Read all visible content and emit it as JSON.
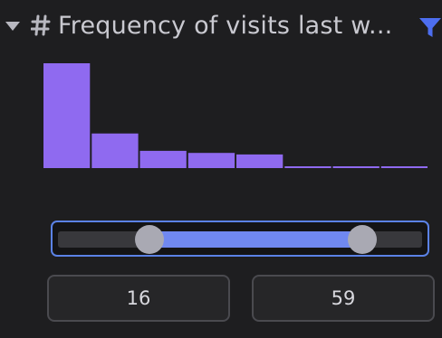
{
  "header": {
    "title": "Frequency of visits last w...",
    "collapse_icon": "caret-down-icon",
    "type_icon": "hash-icon",
    "filter_icon": "filter-icon"
  },
  "histogram": {
    "bar_color": "#8f6af0",
    "relative_heights": [
      1.0,
      0.33,
      0.165,
      0.145,
      0.13,
      0.015,
      0.015,
      0.015
    ]
  },
  "range": {
    "min_value": "16",
    "max_value": "59",
    "slider_low_fraction": 0.25,
    "slider_high_fraction": 0.835,
    "accent_color": "#5b82e6",
    "fill_color": "#7088f0"
  }
}
